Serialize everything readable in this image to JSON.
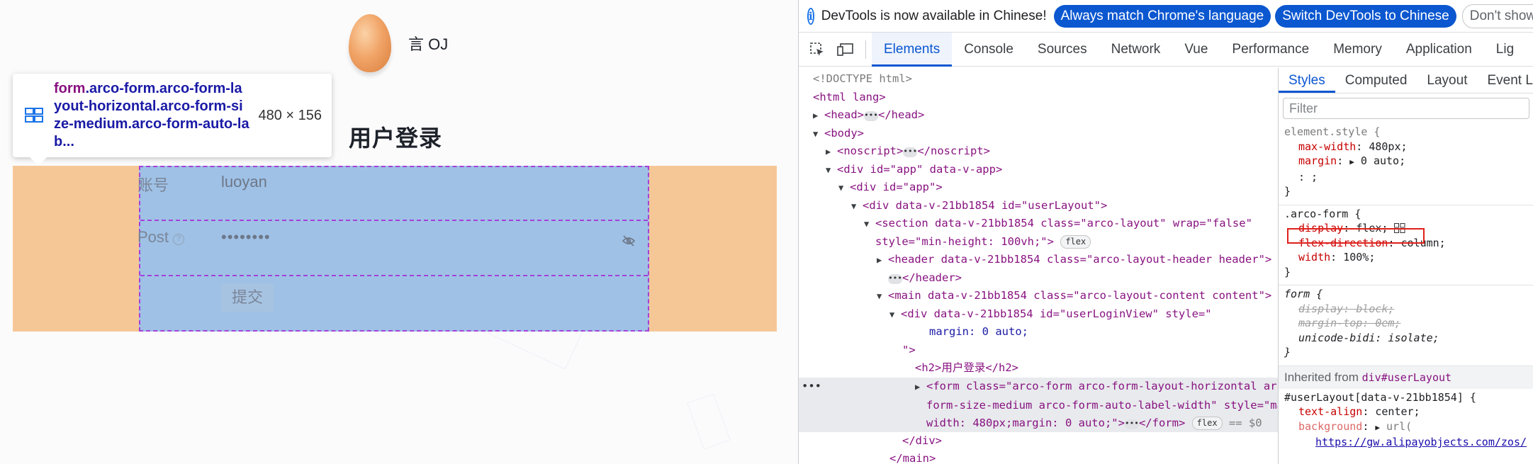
{
  "page": {
    "brand_name": "言 OJ",
    "login_title": "用户登录",
    "tooltip": {
      "selector_tag": "form",
      "selector_rest": ".arco-form.arco-form-layout-horizontal.arco-form-size-medium.arco-form-auto-lab...",
      "size": "480 × 156"
    },
    "form": {
      "account_label": "账号",
      "account_value": "luoyan",
      "password_label": "Post",
      "password_value": "••••••••",
      "submit_label": "提交"
    }
  },
  "devtools": {
    "infobar": {
      "text": "DevTools is now available in Chinese!",
      "btn_match": "Always match Chrome's language",
      "btn_switch": "Switch DevTools to Chinese",
      "btn_dont": "Don't show"
    },
    "tabs": [
      "Elements",
      "Console",
      "Sources",
      "Network",
      "Vue",
      "Performance",
      "Memory",
      "Application",
      "Lig"
    ],
    "styles_tabs": [
      "Styles",
      "Computed",
      "Layout",
      "Event L"
    ],
    "filter_placeholder": "Filter",
    "dom": {
      "doctype": "<!DOCTYPE html>",
      "html": "<html lang>",
      "head": "<head>",
      "head_close": "</head>",
      "body": "<body>",
      "noscript": "<noscript>",
      "noscript_close": "</noscript>",
      "app_div": "<div id=\"app\" data-v-app>",
      "app_div2": "<div id=\"app\">",
      "user_layout": "<div data-v-21bb1854 id=\"userLayout\">",
      "section_1": "<section data-v-21bb1854 class=\"arco-layout\" wrap=\"false\"",
      "section_2": "style=\"min-height: 100vh;\">",
      "header_1": "<header data-v-21bb1854 class=\"arco-layout-header header\">",
      "header_close": "</header>",
      "main": "<main data-v-21bb1854 class=\"arco-layout-content content\">",
      "login_view_1": "<div data-v-21bb1854 id=\"userLoginView\" style=\"",
      "login_view_2": "margin: 0 auto;",
      "login_view_3": "\">",
      "h2": "<h2>用户登录</h2>",
      "form_1": "<form class=\"arco-form arco-form-layout-horizontal arco-",
      "form_2": "form-size-medium arco-form-auto-label-width\" style=\"max-",
      "form_3": "width: 480px;margin: 0 auto;\">",
      "form_close": "</form>",
      "form_eq": "== $0",
      "div_close": "</div>",
      "main_close": "</main>",
      "flex_badge": "flex",
      "dots": "•••"
    },
    "styles": {
      "element_style": "element.style {",
      "max_width_name": "max-width",
      "max_width_value": "480px;",
      "margin_name": "margin",
      "margin_value": "0 auto;",
      "empty_decl": ": ;",
      "close_brace": "}",
      "arco_form_selector": ".arco-form {",
      "display_name": "display",
      "display_value": "flex;",
      "flex_dir_name": "flex-direction",
      "flex_dir_value": "column;",
      "width_name": "width",
      "width_value": "100%;",
      "form_selector": "form {",
      "ua_display": "display: block;",
      "ua_margin_top": "margin-top: 0em;",
      "ua_unicode": "unicode-bidi: isolate;",
      "inherited_label": "Inherited from",
      "inherited_from": "div#userLayout",
      "user_layout_selector": "#userLayout[data-v-21bb1854] {",
      "text_align_name": "text-align",
      "text_align_value": "center;",
      "background_name": "background",
      "background_value": "url(",
      "background_url": "https://gw.alipayobjects.com/zos/"
    }
  }
}
